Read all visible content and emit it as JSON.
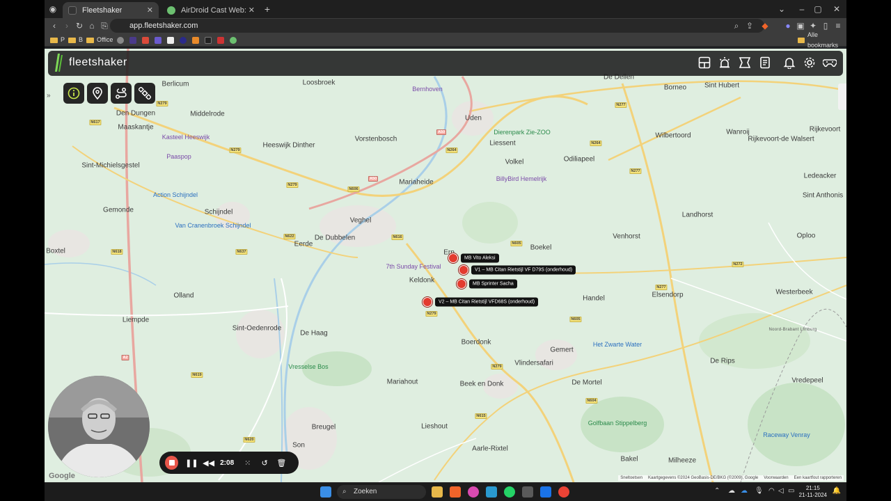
{
  "browser": {
    "tabs": [
      {
        "title": "Fleetshaker",
        "active": true
      },
      {
        "title": "AirDroid Cast Web: Free tool to wir",
        "active": false
      }
    ],
    "url": "app.fleetshaker.com",
    "bookmarks": [
      "P",
      "B",
      "Office"
    ],
    "all_bookmarks": "Alle bookmarks"
  },
  "app": {
    "brand": "fleetshaker"
  },
  "map": {
    "towns": [
      {
        "name": "Berlicum",
        "cls": ""
      },
      {
        "name": "Loosbroek",
        "cls": ""
      },
      {
        "name": "Bernhoven",
        "cls": "poi"
      },
      {
        "name": "Den Dungen",
        "cls": ""
      },
      {
        "name": "Middelrode",
        "cls": ""
      },
      {
        "name": "Maaskantje",
        "cls": ""
      },
      {
        "name": "Uden",
        "cls": ""
      },
      {
        "name": "Heeswijk Dinther",
        "cls": ""
      },
      {
        "name": "Vorstenbosch",
        "cls": ""
      },
      {
        "name": "Kasteel Heeswijk",
        "cls": "poi"
      },
      {
        "name": "Paaspop",
        "cls": "poi"
      },
      {
        "name": "Sint-Michielsgestel",
        "cls": ""
      },
      {
        "name": "Mariaheide",
        "cls": ""
      },
      {
        "name": "Liessent",
        "cls": ""
      },
      {
        "name": "Dierenpark Zie-ZOO",
        "cls": "poi-green"
      },
      {
        "name": "Volkel",
        "cls": ""
      },
      {
        "name": "Odiliapeel",
        "cls": ""
      },
      {
        "name": "BillyBird Hemelrijk",
        "cls": "poi"
      },
      {
        "name": "Action Schijndel",
        "cls": "poi-blue"
      },
      {
        "name": "Gemonde",
        "cls": ""
      },
      {
        "name": "Schijndel",
        "cls": ""
      },
      {
        "name": "Van Cranenbroek Schijndel",
        "cls": "poi-blue"
      },
      {
        "name": "Veghel",
        "cls": ""
      },
      {
        "name": "De Dubbelen",
        "cls": ""
      },
      {
        "name": "Eerde",
        "cls": ""
      },
      {
        "name": "Boxtel",
        "cls": ""
      },
      {
        "name": "Erp",
        "cls": ""
      },
      {
        "name": "7th Sunday Festival",
        "cls": "poi"
      },
      {
        "name": "Boekel",
        "cls": ""
      },
      {
        "name": "Keldonk",
        "cls": ""
      },
      {
        "name": "Olland",
        "cls": ""
      },
      {
        "name": "Liempde",
        "cls": ""
      },
      {
        "name": "Handel",
        "cls": ""
      },
      {
        "name": "Venhorst",
        "cls": ""
      },
      {
        "name": "Sint-Oedenrode",
        "cls": ""
      },
      {
        "name": "De Haag",
        "cls": ""
      },
      {
        "name": "Boerdonk",
        "cls": ""
      },
      {
        "name": "Gemert",
        "cls": ""
      },
      {
        "name": "Het Zwarte Water",
        "cls": "poi-blue"
      },
      {
        "name": "Vlindersafari",
        "cls": ""
      },
      {
        "name": "Elsendorp",
        "cls": ""
      },
      {
        "name": "Westerbeek",
        "cls": ""
      },
      {
        "name": "Vresselse Bos",
        "cls": "poi-green"
      },
      {
        "name": "Mariahout",
        "cls": ""
      },
      {
        "name": "Beek en Donk",
        "cls": ""
      },
      {
        "name": "De Mortel",
        "cls": ""
      },
      {
        "name": "De Rips",
        "cls": ""
      },
      {
        "name": "Vredepeel",
        "cls": ""
      },
      {
        "name": "Breugel",
        "cls": ""
      },
      {
        "name": "Lieshout",
        "cls": ""
      },
      {
        "name": "Aarle-Rixtel",
        "cls": ""
      },
      {
        "name": "Golfbaan Stippelberg",
        "cls": "poi-green"
      },
      {
        "name": "Bakel",
        "cls": ""
      },
      {
        "name": "Milheeze",
        "cls": ""
      },
      {
        "name": "Son",
        "cls": ""
      },
      {
        "name": "Raceway Venray",
        "cls": "poi-blue"
      },
      {
        "name": "De Dellen",
        "cls": ""
      },
      {
        "name": "Borneo",
        "cls": ""
      },
      {
        "name": "Sint Hubert",
        "cls": ""
      },
      {
        "name": "Wilbertoord",
        "cls": ""
      },
      {
        "name": "Wanroij",
        "cls": ""
      },
      {
        "name": "Rijkevoort-de Walsert",
        "cls": ""
      },
      {
        "name": "Rijkevoort",
        "cls": ""
      },
      {
        "name": "Ledeacker",
        "cls": ""
      },
      {
        "name": "Sint Anthonis",
        "cls": ""
      },
      {
        "name": "Landhorst",
        "cls": ""
      },
      {
        "name": "Oploo",
        "cls": ""
      },
      {
        "name": "Noord-Brabant Limburg",
        "cls": "small"
      }
    ],
    "roads": [
      {
        "name": "N279",
        "kind": ""
      },
      {
        "name": "N617",
        "kind": ""
      },
      {
        "name": "N279",
        "kind": ""
      },
      {
        "name": "A50",
        "kind": "a"
      },
      {
        "name": "N264",
        "kind": ""
      },
      {
        "name": "N277",
        "kind": ""
      },
      {
        "name": "N264",
        "kind": ""
      },
      {
        "name": "N606",
        "kind": ""
      },
      {
        "name": "A50",
        "kind": "a"
      },
      {
        "name": "N279",
        "kind": ""
      },
      {
        "name": "N616",
        "kind": ""
      },
      {
        "name": "N605",
        "kind": ""
      },
      {
        "name": "N618",
        "kind": ""
      },
      {
        "name": "N637",
        "kind": ""
      },
      {
        "name": "N622",
        "kind": ""
      },
      {
        "name": "N279",
        "kind": ""
      },
      {
        "name": "N272",
        "kind": ""
      },
      {
        "name": "N277",
        "kind": ""
      },
      {
        "name": "N605",
        "kind": ""
      },
      {
        "name": "N279",
        "kind": ""
      },
      {
        "name": "N615",
        "kind": ""
      },
      {
        "name": "N604",
        "kind": ""
      },
      {
        "name": "N619",
        "kind": ""
      },
      {
        "name": "N620",
        "kind": ""
      },
      {
        "name": "A2",
        "kind": "a"
      },
      {
        "name": "N277",
        "kind": ""
      }
    ],
    "vehicles": [
      {
        "label": "MB Vito Aleksi"
      },
      {
        "label": "V1 – MB Citan Rietstijl VF D79S (onderhoud)"
      },
      {
        "label": "MB Sprinter Sacha"
      },
      {
        "label": "V2 – MB Citan Rietstijl VFD68S (onderhoud)"
      }
    ],
    "attribution": [
      "Sneltoetsen",
      "Kaartgegevens ©2024 GeoBasis-DE/BKG (©2009), Google",
      "Voorwaarden",
      "Een kaartfout rapporteren"
    ],
    "google": "Google"
  },
  "recorder": {
    "time": "2:08"
  },
  "taskbar": {
    "search": "Zoeken",
    "time": "21:15",
    "date": "21-11-2024"
  }
}
